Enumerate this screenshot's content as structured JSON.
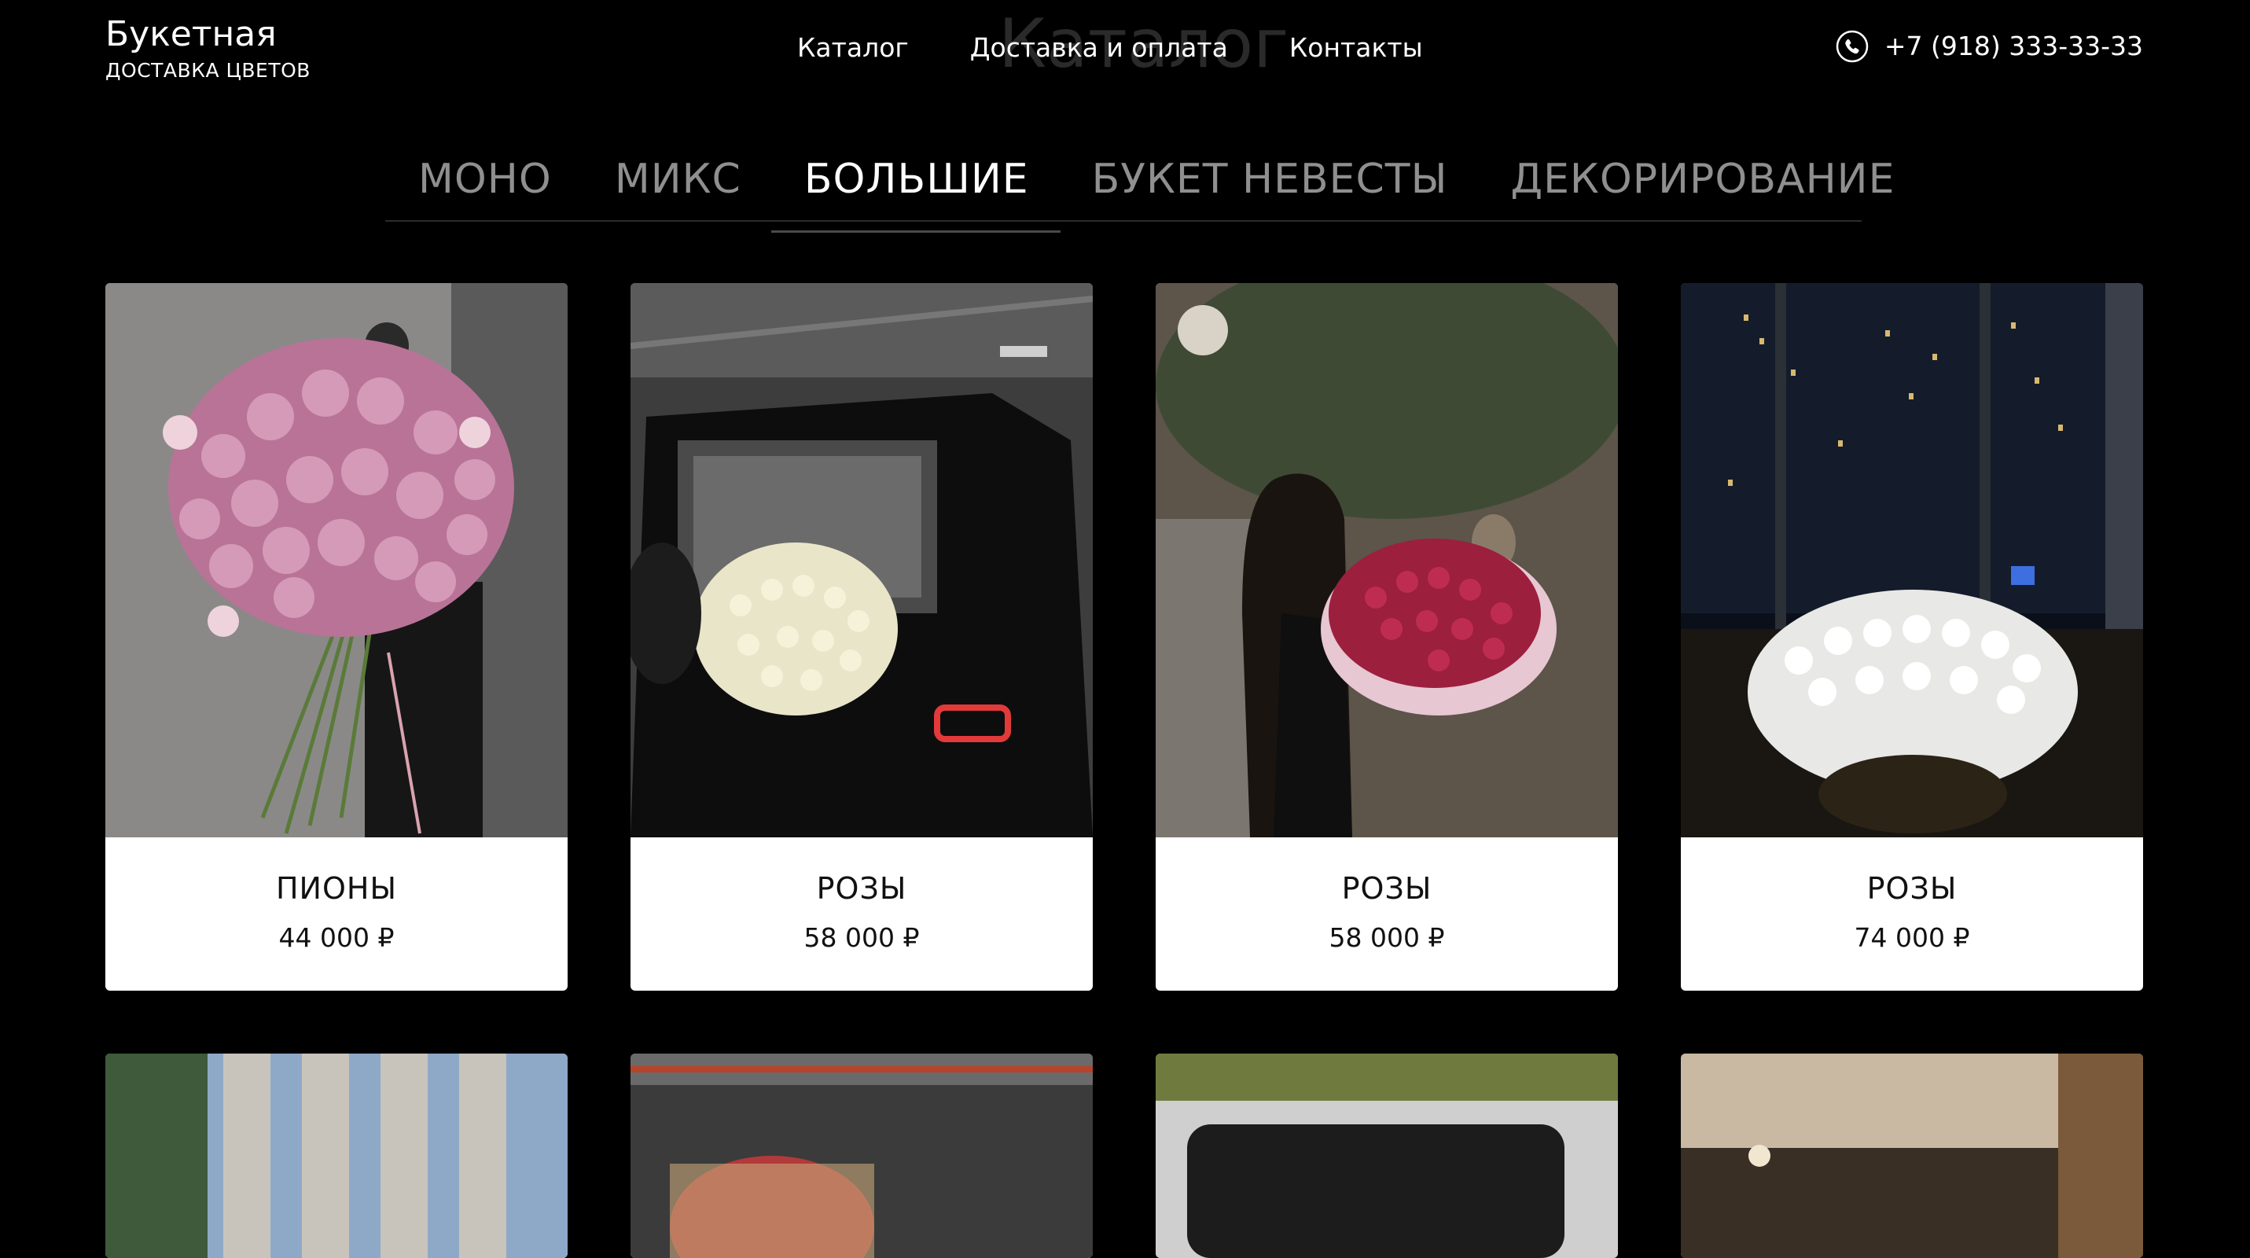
{
  "brand": {
    "title": "Букетная",
    "subtitle": "ДОСТАВКА ЦВЕТОВ"
  },
  "watermark": "Каталог",
  "nav": {
    "items": [
      "Каталог",
      "Доставка и оплата",
      "Контакты"
    ]
  },
  "phone": {
    "number": "+7 (918) 333-33-33",
    "icon": "phone-icon"
  },
  "tabs": [
    {
      "label": "МОНО",
      "active": false
    },
    {
      "label": "МИКС",
      "active": false
    },
    {
      "label": "БОЛЬШИЕ",
      "active": true
    },
    {
      "label": "БУКЕТ НЕВЕСТЫ",
      "active": false
    },
    {
      "label": "ДЕКОРИРОВАНИЕ",
      "active": false
    }
  ],
  "products": [
    {
      "name": "ПИОНЫ",
      "price": "44 000 ₽"
    },
    {
      "name": "РОЗЫ",
      "price": "58 000 ₽"
    },
    {
      "name": "РОЗЫ",
      "price": "58 000 ₽"
    },
    {
      "name": "РОЗЫ",
      "price": "74 000 ₽"
    }
  ],
  "colors": {
    "background": "#000000",
    "card": "#ffffff",
    "tab_inactive": "#8f8f8f",
    "tab_active": "#ffffff",
    "watermark": "#2a2a2a"
  }
}
